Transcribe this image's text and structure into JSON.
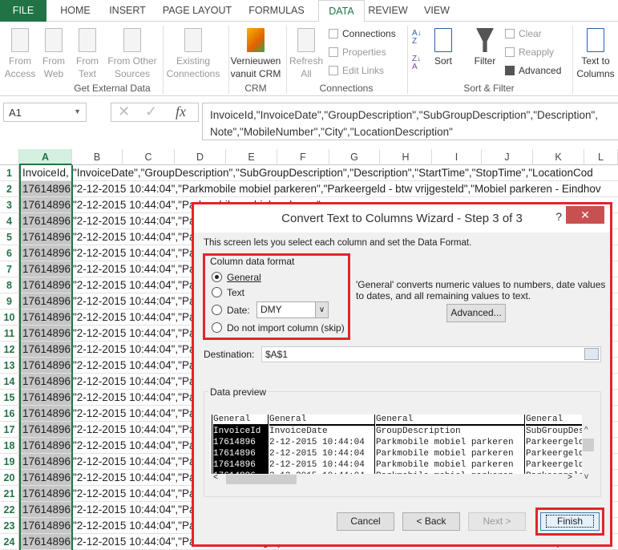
{
  "tabs": [
    "FILE",
    "HOME",
    "INSERT",
    "PAGE LAYOUT",
    "FORMULAS",
    "DATA",
    "REVIEW",
    "VIEW"
  ],
  "active_tab": "DATA",
  "ribbon": {
    "get_external": {
      "from_access": "From Access",
      "from_web": "From Web",
      "from_text": "From Text",
      "from_other": "From Other Sources",
      "existing": "Existing Connections",
      "label": "Get External Data"
    },
    "crm": {
      "refresh": "Vernieuwen vanuit CRM",
      "label": "CRM"
    },
    "connections": {
      "refresh_all": "Refresh All",
      "connections": "Connections",
      "properties": "Properties",
      "edit_links": "Edit Links",
      "label": "Connections"
    },
    "sort_filter": {
      "sort": "Sort",
      "filter": "Filter",
      "clear": "Clear",
      "reapply": "Reapply",
      "advanced": "Advanced",
      "label": "Sort & Filter"
    },
    "text_to_columns": "Text to Columns"
  },
  "formula_bar": {
    "name_box": "A1",
    "fx": "fx",
    "line1": "InvoiceId,\"InvoiceDate\",\"GroupDescription\",\"SubGroupDescription\",\"Description\",",
    "line2": "Note\",\"MobileNumber\",\"City\",\"LocationDescription\""
  },
  "columns": [
    "A",
    "B",
    "C",
    "D",
    "E",
    "F",
    "G",
    "H",
    "I",
    "J",
    "K",
    "L"
  ],
  "rows": [
    {
      "n": "1",
      "a": "InvoiceId,",
      "rest": "\"InvoiceDate\",\"GroupDescription\",\"SubGroupDescription\",\"Description\",\"StartTime\",\"StopTime\",\"LocationCod"
    },
    {
      "n": "2",
      "a": "17614896,",
      "rest": "\"2-12-2015 10:44:04\",\"Parkmobile mobiel parkeren\",\"Parkeergeld - btw vrijgesteld\",\"Mobiel parkeren - Eindhov"
    },
    {
      "n": "3",
      "a": "17614896,",
      "rest": "\"2-12-2015 10:44:04\",\"Parkmobile mobiel parkeren\""
    },
    {
      "n": "4",
      "a": "17614896,",
      "rest": "\"2-12-2015 10:44:04\",\"Parkmobile mobiel parkeren\""
    },
    {
      "n": "5",
      "a": "17614896,",
      "rest": "\"2-12-2015 10:44:04\",\"Parkmobile mobiel parkeren\""
    },
    {
      "n": "6",
      "a": "17614896,",
      "rest": "\"2-12-2015 10:44:04\",\"Parkmobile mobiel parkeren\""
    },
    {
      "n": "7",
      "a": "17614896,",
      "rest": "\"2-12-2015 10:44:04\",\"Parkmobile mobiel parkeren\""
    },
    {
      "n": "8",
      "a": "17614896,",
      "rest": "\"2-12-2015 10:44:04\",\"Parkmobile mobiel parkeren\""
    },
    {
      "n": "9",
      "a": "17614896,",
      "rest": "\"2-12-2015 10:44:04\",\"Parkmobile mobiel parkeren\""
    },
    {
      "n": "10",
      "a": "17614896,",
      "rest": "\"2-12-2015 10:44:04\",\"Parkmobile mobiel parkeren\""
    },
    {
      "n": "11",
      "a": "17614896,",
      "rest": "\"2-12-2015 10:44:04\",\"Parkmobile mobiel parkeren\""
    },
    {
      "n": "12",
      "a": "17614896,",
      "rest": "\"2-12-2015 10:44:04\",\"Parkmobile mobiel parkeren\""
    },
    {
      "n": "13",
      "a": "17614896,",
      "rest": "\"2-12-2015 10:44:04\",\"Parkmobile mobiel parkeren\""
    },
    {
      "n": "14",
      "a": "17614896,",
      "rest": "\"2-12-2015 10:44:04\",\"Parkmobile mobiel parkeren\""
    },
    {
      "n": "15",
      "a": "17614896,",
      "rest": "\"2-12-2015 10:44:04\",\"Parkmobile mobiel parkeren\""
    },
    {
      "n": "16",
      "a": "17614896,",
      "rest": "\"2-12-2015 10:44:04\",\"Parkmobile mobiel parkeren\""
    },
    {
      "n": "17",
      "a": "17614896,",
      "rest": "\"2-12-2015 10:44:04\",\"Parkmobile mobiel parkeren\""
    },
    {
      "n": "18",
      "a": "17614896,",
      "rest": "\"2-12-2015 10:44:04\",\"Parkmobile mobiel parkeren\""
    },
    {
      "n": "19",
      "a": "17614896,",
      "rest": "\"2-12-2015 10:44:04\",\"Parkmobile mobiel parkeren\""
    },
    {
      "n": "20",
      "a": "17614896,",
      "rest": "\"2-12-2015 10:44:04\",\"Parkmobile mobiel parkeren\""
    },
    {
      "n": "21",
      "a": "17614896,",
      "rest": "\"2-12-2015 10:44:04\",\"Parkmobile mobiel parkeren\""
    },
    {
      "n": "22",
      "a": "17614896,",
      "rest": "\"2-12-2015 10:44:04\",\"Parkmobile mobiel parkeren\""
    },
    {
      "n": "23",
      "a": "17614896,",
      "rest": "\"2-12-2015 10:44:04\",\"Parkmobile mobiel parkeren\""
    },
    {
      "n": "24",
      "a": "17614896,",
      "rest": "\"2-12-2015 10:44:04\",\"Parkmobile overige producten\",\"Transactiekosten\",\"Transactiekosten\",\"Mobiel parkeren -"
    }
  ],
  "dialog": {
    "title": "Convert Text to Columns Wizard - Step 3 of 3",
    "help": "?",
    "close": "✕",
    "intro": "This screen lets you select each column and set the Data Format.",
    "group_label": "Column data format",
    "options": [
      "General",
      "Text",
      "Date:",
      "Do not import column (skip)"
    ],
    "selected_option": "General",
    "date_format": "DMY",
    "description_line1": "'General' converts numeric values to numbers, date values",
    "description_line2": "to dates, and all remaining values to text.",
    "advanced": "Advanced...",
    "destination_label": "Destination:",
    "destination_value": "$A$1",
    "preview_label": "Data preview",
    "preview": {
      "headers": [
        "General",
        "General",
        "General",
        "General"
      ],
      "columns": [
        [
          "InvoiceId",
          "17614896",
          "17614896",
          "17614896",
          "17614896"
        ],
        [
          "InvoiceDate",
          "2-12-2015 10:44:04",
          "2-12-2015 10:44:04",
          "2-12-2015 10:44:04",
          "2-12-2015 10:44:04"
        ],
        [
          "GroupDescription",
          "Parkmobile mobiel parkeren",
          "Parkmobile mobiel parkeren",
          "Parkmobile mobiel parkeren",
          "Parkmobile mobiel parkeren"
        ],
        [
          "SubGroupDescription",
          "Parkeergeld",
          "Parkeergeld",
          "Parkeergeld",
          "Parkeergeld"
        ]
      ]
    },
    "buttons": {
      "cancel": "Cancel",
      "back": "< Back",
      "next": "Next >",
      "finish": "Finish"
    }
  },
  "colors": {
    "excel_green": "#217346",
    "highlight_red": "#e3242b",
    "close_red": "#c75050"
  }
}
